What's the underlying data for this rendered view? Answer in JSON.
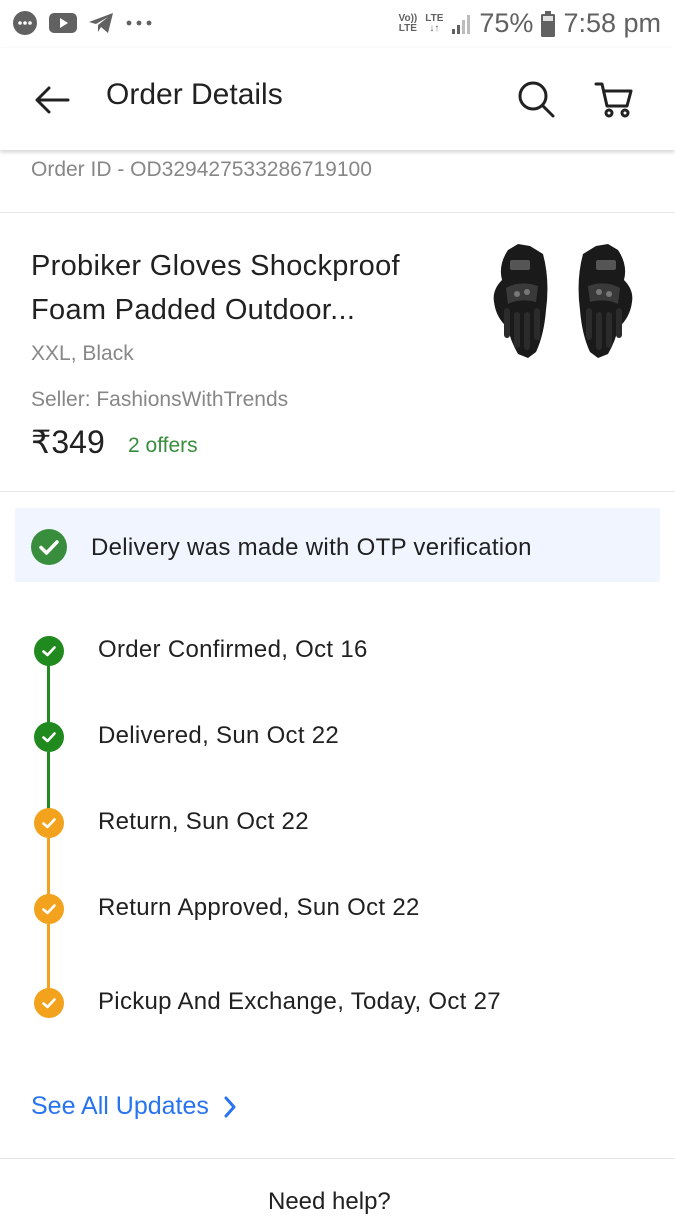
{
  "status_bar": {
    "volte_top": "Vo))",
    "volte_bottom": "LTE",
    "lte_top": "LTE",
    "lte_bottom": "↓↑",
    "battery_percent": "75%",
    "time": "7:58 pm"
  },
  "header": {
    "title": "Order Details"
  },
  "order": {
    "id_text": "Order ID - OD329427533286719100"
  },
  "product": {
    "name": "Probiker Gloves Shockproof Foam Padded Outdoor...",
    "variant": "XXL, Black",
    "seller": "Seller: FashionsWithTrends",
    "price": "₹349",
    "offers": "2 offers"
  },
  "otp_banner": {
    "text": "Delivery was made with OTP verification"
  },
  "timeline": [
    {
      "label": "Order Confirmed, Oct 16",
      "status": "green"
    },
    {
      "label": "Delivered, Sun Oct 22",
      "status": "green"
    },
    {
      "label": "Return, Sun Oct 22",
      "status": "orange"
    },
    {
      "label": "Return Approved, Sun Oct 22",
      "status": "orange"
    },
    {
      "label": "Pickup And Exchange, Today, Oct 27",
      "status": "orange"
    }
  ],
  "see_all": {
    "label": "See All Updates"
  },
  "footer": {
    "need_help": "Need help?"
  },
  "colors": {
    "green": "#218a1f",
    "orange": "#f2a21d",
    "accent_blue": "#2874f0",
    "offer_green": "#388e3c",
    "banner_bg": "#f0f5ff"
  },
  "icons": {
    "back": "arrow-left-icon",
    "search": "search-icon",
    "cart": "cart-icon",
    "check": "check-circle-icon",
    "chevron": "chevron-right-icon"
  }
}
